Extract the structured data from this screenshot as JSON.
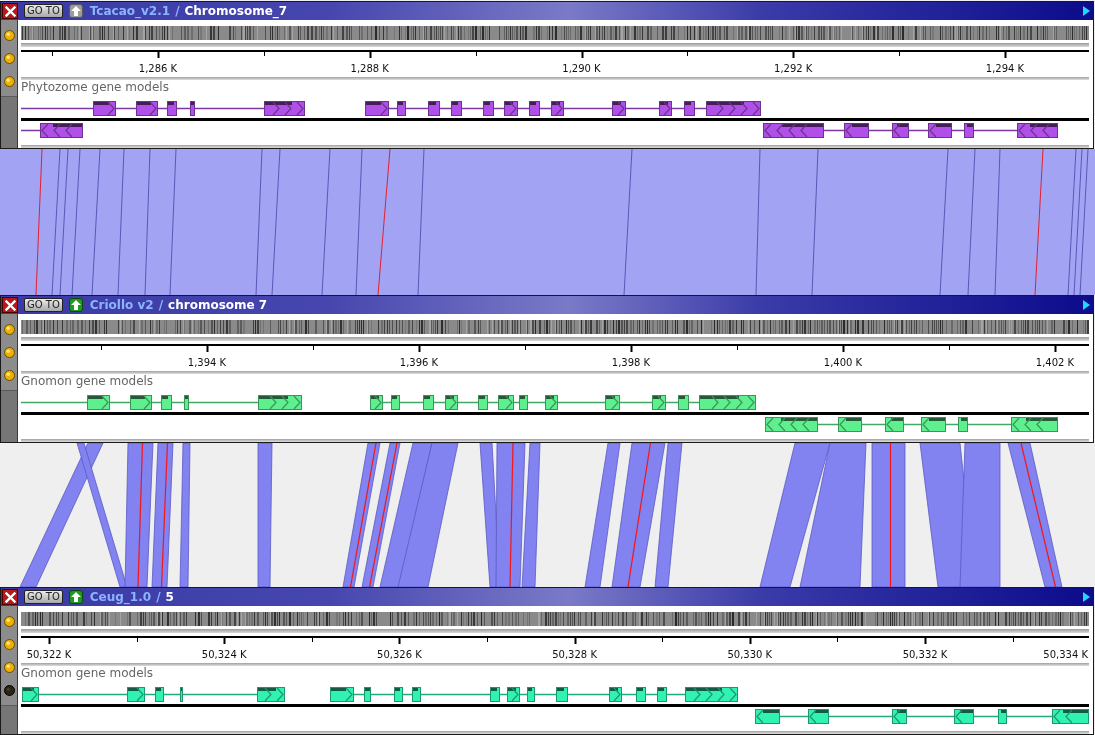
{
  "panels": [
    {
      "goto_label": "GO TO",
      "move_up": {
        "disabled": true
      },
      "genome": "Tcacao_v2.1",
      "separator": "/",
      "chromosome": "Chromosome_7",
      "indicators": [
        {
          "on": true
        },
        {
          "on": true
        },
        {
          "on": true
        }
      ],
      "axis_labels": [
        "1,286 K",
        "1,288 K",
        "1,290 K",
        "1,292 K",
        "1,294 K"
      ],
      "track": {
        "label": "Phytozome gene models",
        "color": "#b050e8"
      }
    },
    {
      "goto_label": "GO TO",
      "move_up": {
        "disabled": false
      },
      "genome": "Criollo v2",
      "separator": "/",
      "chromosome": "chromosome 7",
      "indicators": [
        {
          "on": true
        },
        {
          "on": true
        },
        {
          "on": true
        }
      ],
      "axis_labels": [
        "1,394 K",
        "1,396 K",
        "1,398 K",
        "1,400 K",
        "1,402 K"
      ],
      "track": {
        "label": "Gnomon gene models",
        "color": "#5ef08e"
      }
    },
    {
      "goto_label": "GO TO",
      "move_up": {
        "disabled": false
      },
      "genome": "Ceug_1.0",
      "separator": "/",
      "chromosome": "5",
      "indicators": [
        {
          "on": true
        },
        {
          "on": true
        },
        {
          "on": true
        },
        {
          "on": false
        }
      ],
      "axis_labels": [
        "50,322 K",
        "50,324 K",
        "50,326 K",
        "50,328 K",
        "50,330 K",
        "50,332 K",
        "50,334 K"
      ],
      "track": {
        "label": "Gnomon gene models",
        "color": "#30f2b2"
      }
    }
  ]
}
